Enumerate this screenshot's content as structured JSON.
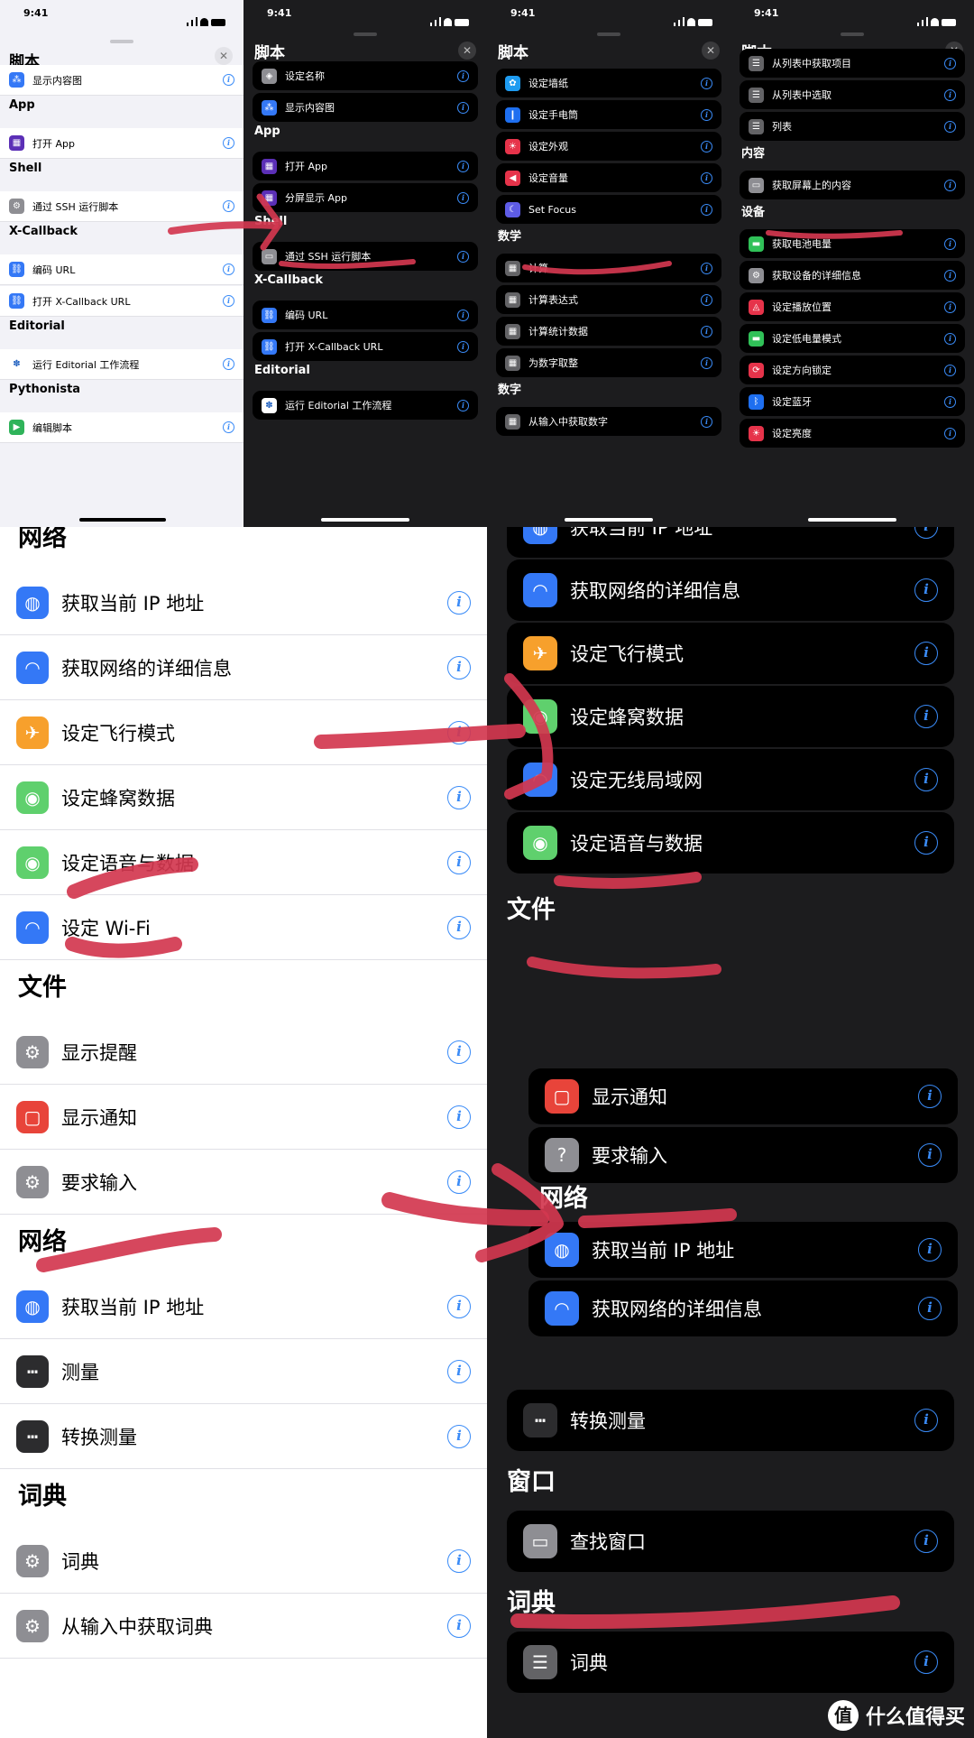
{
  "status_time": "9:41",
  "sheet_title": "脚本",
  "close_glyph": "✕",
  "info_glyph": "i",
  "p1": {
    "items": [
      {
        "type": "row",
        "label": "显示内容图",
        "icon": "content-graph-icon",
        "color": "#3478f6",
        "glyph": "⁂"
      },
      {
        "type": "sec",
        "label": "App"
      },
      {
        "type": "row",
        "label": "打开 App",
        "icon": "apps-grid-icon",
        "color": "#5b2fb6",
        "glyph": "▦"
      },
      {
        "type": "sec",
        "label": "Shell"
      },
      {
        "type": "row",
        "label": "通过 SSH 运行脚本",
        "icon": "gear-icon",
        "color": "#8e8e93",
        "glyph": "⚙"
      },
      {
        "type": "sec",
        "label": "X-Callback"
      },
      {
        "type": "row",
        "label": "编码 URL",
        "icon": "link-icon",
        "color": "#3478f6",
        "glyph": "⛓"
      },
      {
        "type": "row",
        "label": "打开 X-Callback URL",
        "icon": "link-icon",
        "color": "#3478f6",
        "glyph": "⛓"
      },
      {
        "type": "sec",
        "label": "Editorial"
      },
      {
        "type": "row",
        "label": "运行 Editorial 工作流程",
        "icon": "editorial-icon",
        "color": "#ffffff",
        "glyph": "✽"
      },
      {
        "type": "sec",
        "label": "Pythonista"
      },
      {
        "type": "row",
        "label": "编辑脚本",
        "icon": "pythonista-icon",
        "color": "#2fb35a",
        "glyph": "▶"
      }
    ]
  },
  "p2": {
    "items": [
      {
        "type": "row",
        "label": "设定名称",
        "icon": "tag-icon",
        "color": "#8e8e93",
        "glyph": "◈"
      },
      {
        "type": "row",
        "label": "显示内容图",
        "icon": "content-graph-icon",
        "color": "#3478f6",
        "glyph": "⁂"
      },
      {
        "type": "sec",
        "label": "App"
      },
      {
        "type": "row",
        "label": "打开 App",
        "icon": "apps-grid-icon",
        "color": "#5b2fb6",
        "glyph": "▦"
      },
      {
        "type": "row",
        "label": "分屏显示 App",
        "icon": "apps-grid-icon",
        "color": "#5b2fb6",
        "glyph": "▦"
      },
      {
        "type": "sec",
        "label": "Shell"
      },
      {
        "type": "row",
        "label": "通过 SSH 运行脚本",
        "icon": "terminal-icon",
        "color": "#8e8e93",
        "glyph": "▭"
      },
      {
        "type": "sec",
        "label": "X-Callback"
      },
      {
        "type": "row",
        "label": "编码 URL",
        "icon": "link-icon",
        "color": "#3478f6",
        "glyph": "⛓"
      },
      {
        "type": "row",
        "label": "打开 X-Callback URL",
        "icon": "link-icon",
        "color": "#3478f6",
        "glyph": "⛓"
      },
      {
        "type": "sec",
        "label": "Editorial"
      },
      {
        "type": "row",
        "label": "运行 Editorial 工作流程",
        "icon": "editorial-icon",
        "color": "#ffffff",
        "glyph": "✽"
      }
    ]
  },
  "p3": {
    "items": [
      {
        "type": "row",
        "label": "设定墙纸",
        "icon": "wallpaper-icon",
        "color": "#1e9bf0",
        "glyph": "✿"
      },
      {
        "type": "row",
        "label": "设定手电筒",
        "icon": "flashlight-icon",
        "color": "#1e6ff0",
        "glyph": "❙"
      },
      {
        "type": "row",
        "label": "设定外观",
        "icon": "appearance-icon",
        "color": "#e6334a",
        "glyph": "☀"
      },
      {
        "type": "row",
        "label": "设定音量",
        "icon": "volume-icon",
        "color": "#e6334a",
        "glyph": "◀"
      },
      {
        "type": "row",
        "label": "Set Focus",
        "icon": "moon-icon",
        "color": "#5e5ce6",
        "glyph": "☾"
      },
      {
        "type": "sec",
        "label": "数学"
      },
      {
        "type": "row",
        "label": "计算",
        "icon": "calculator-icon",
        "color": "#636366",
        "glyph": "▦"
      },
      {
        "type": "row",
        "label": "计算表达式",
        "icon": "calculator-icon",
        "color": "#636366",
        "glyph": "▦"
      },
      {
        "type": "row",
        "label": "计算统计数据",
        "icon": "calculator-icon",
        "color": "#636366",
        "glyph": "▦"
      },
      {
        "type": "row",
        "label": "为数字取整",
        "icon": "calculator-icon",
        "color": "#636366",
        "glyph": "▦"
      },
      {
        "type": "sec",
        "label": "数字"
      },
      {
        "type": "row",
        "label": "从输入中获取数字",
        "icon": "calculator-icon",
        "color": "#636366",
        "glyph": "▦"
      }
    ]
  },
  "p4": {
    "items": [
      {
        "type": "row",
        "label": "从列表中获取项目",
        "icon": "list-icon",
        "color": "#636366",
        "glyph": "☰"
      },
      {
        "type": "row",
        "label": "从列表中选取",
        "icon": "list-icon",
        "color": "#636366",
        "glyph": "☰"
      },
      {
        "type": "row",
        "label": "列表",
        "icon": "list-icon",
        "color": "#636366",
        "glyph": "☰"
      },
      {
        "type": "sec",
        "label": "内容"
      },
      {
        "type": "row",
        "label": "获取屏幕上的内容",
        "icon": "screen-icon",
        "color": "#8e8e93",
        "glyph": "▭"
      },
      {
        "type": "sec",
        "label": "设备"
      },
      {
        "type": "row",
        "label": "获取电池电量",
        "icon": "battery-icon",
        "color": "#30c158",
        "glyph": "▬"
      },
      {
        "type": "row",
        "label": "获取设备的详细信息",
        "icon": "gear-icon",
        "color": "#8e8e93",
        "glyph": "⚙"
      },
      {
        "type": "row",
        "label": "设定播放位置",
        "icon": "airplay-icon",
        "color": "#e6334a",
        "glyph": "◬"
      },
      {
        "type": "row",
        "label": "设定低电量模式",
        "icon": "battery-icon",
        "color": "#30c158",
        "glyph": "▬"
      },
      {
        "type": "row",
        "label": "设定方向锁定",
        "icon": "rotation-lock-icon",
        "color": "#e6334a",
        "glyph": "⟳"
      },
      {
        "type": "row",
        "label": "设定蓝牙",
        "icon": "bluetooth-icon",
        "color": "#1e6ff0",
        "glyph": "ᛒ"
      },
      {
        "type": "row",
        "label": "设定亮度",
        "icon": "brightness-icon",
        "color": "#e6334a",
        "glyph": "☀"
      }
    ]
  },
  "p5": {
    "items": [
      {
        "type": "sec",
        "label": "网络"
      },
      {
        "type": "row",
        "label": "获取当前 IP 地址",
        "icon": "globe-icon",
        "color": "#3478f6",
        "glyph": "◍"
      },
      {
        "type": "row",
        "label": "获取网络的详细信息",
        "icon": "wifi-icon",
        "color": "#3478f6",
        "glyph": "◠"
      },
      {
        "type": "row",
        "label": "设定飞行模式",
        "icon": "airplane-icon",
        "color": "#f7a02c",
        "glyph": "✈"
      },
      {
        "type": "row",
        "label": "设定蜂窝数据",
        "icon": "antenna-icon",
        "color": "#5fd06d",
        "glyph": "◉"
      },
      {
        "type": "row",
        "label": "设定语音与数据",
        "icon": "antenna-icon",
        "color": "#5fd06d",
        "glyph": "◉"
      },
      {
        "type": "row",
        "label": "设定 Wi-Fi",
        "icon": "wifi-icon",
        "color": "#3478f6",
        "glyph": "◠"
      },
      {
        "type": "sec",
        "label": "文件"
      },
      {
        "type": "row",
        "label": "显示提醒",
        "icon": "gear-icon",
        "color": "#8e8e93",
        "glyph": "⚙"
      },
      {
        "type": "row",
        "label": "显示通知",
        "icon": "notification-icon",
        "color": "#e8443a",
        "glyph": "▢"
      },
      {
        "type": "row",
        "label": "要求输入",
        "icon": "gear-icon",
        "color": "#8e8e93",
        "glyph": "⚙"
      },
      {
        "type": "sec",
        "label": "网络"
      },
      {
        "type": "row",
        "label": "获取当前 IP 地址",
        "icon": "globe-icon",
        "color": "#3478f6",
        "glyph": "◍"
      },
      {
        "type": "row",
        "label": "测量",
        "icon": "ruler-icon",
        "color": "#2c2c2e",
        "glyph": "┅"
      },
      {
        "type": "row",
        "label": "转换测量",
        "icon": "ruler-icon",
        "color": "#2c2c2e",
        "glyph": "┅"
      },
      {
        "type": "sec",
        "label": "词典"
      },
      {
        "type": "row",
        "label": "词典",
        "icon": "gear-icon",
        "color": "#8e8e93",
        "glyph": "⚙"
      },
      {
        "type": "row",
        "label": "从输入中获取词典",
        "icon": "gear-icon",
        "color": "#8e8e93",
        "glyph": "⚙"
      }
    ]
  },
  "p6": {
    "items": [
      {
        "type": "row",
        "label": "获取当前 IP 地址",
        "icon": "globe-icon",
        "color": "#3478f6",
        "glyph": "◍"
      },
      {
        "type": "row",
        "label": "获取网络的详细信息",
        "icon": "wifi-icon",
        "color": "#3478f6",
        "glyph": "◠"
      },
      {
        "type": "row",
        "label": "设定飞行模式",
        "icon": "airplane-icon",
        "color": "#f7a02c",
        "glyph": "✈"
      },
      {
        "type": "row",
        "label": "设定蜂窝数据",
        "icon": "antenna-icon",
        "color": "#5fd06d",
        "glyph": "◉"
      },
      {
        "type": "row",
        "label": "设定无线局域网",
        "icon": "wifi-icon",
        "color": "#3478f6",
        "glyph": "◠"
      },
      {
        "type": "row",
        "label": "设定语音与数据",
        "icon": "antenna-icon",
        "color": "#5fd06d",
        "glyph": "◉"
      },
      {
        "type": "sec",
        "label": "文件"
      }
    ]
  },
  "p7": {
    "items": [
      {
        "type": "row",
        "label": "显示通知",
        "icon": "notification-icon",
        "color": "#e8443a",
        "glyph": "▢"
      },
      {
        "type": "row",
        "label": "要求输入",
        "icon": "question-icon",
        "color": "#8e8e93",
        "glyph": "?"
      },
      {
        "type": "sec",
        "label": "网络"
      },
      {
        "type": "row",
        "label": "获取当前 IP 地址",
        "icon": "globe-icon",
        "color": "#3478f6",
        "glyph": "◍"
      },
      {
        "type": "row",
        "label": "获取网络的详细信息",
        "icon": "wifi-icon",
        "color": "#3478f6",
        "glyph": "◠"
      }
    ]
  },
  "p8": {
    "items": [
      {
        "type": "row",
        "label": "转换测量",
        "icon": "ruler-icon",
        "color": "#2c2c2e",
        "glyph": "┅"
      },
      {
        "type": "sec",
        "label": "窗口"
      },
      {
        "type": "row",
        "label": "查找窗口",
        "icon": "window-icon",
        "color": "#8e8e93",
        "glyph": "▭"
      },
      {
        "type": "sec",
        "label": "词典"
      },
      {
        "type": "row",
        "label": "词典",
        "icon": "list-icon",
        "color": "#636366",
        "glyph": "☰"
      }
    ]
  },
  "watermark": {
    "logo": "值",
    "text": "什么值得买"
  }
}
